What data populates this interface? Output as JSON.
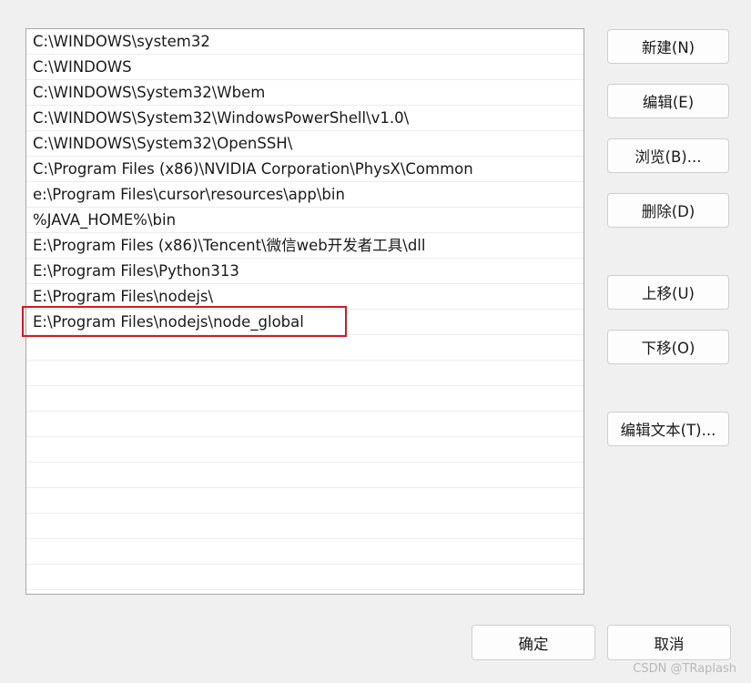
{
  "path_list": {
    "entries": [
      "C:\\WINDOWS\\system32",
      "C:\\WINDOWS",
      "C:\\WINDOWS\\System32\\Wbem",
      "C:\\WINDOWS\\System32\\WindowsPowerShell\\v1.0\\",
      "C:\\WINDOWS\\System32\\OpenSSH\\",
      "C:\\Program Files (x86)\\NVIDIA Corporation\\PhysX\\Common",
      "e:\\Program Files\\cursor\\resources\\app\\bin",
      "%JAVA_HOME%\\bin",
      "E:\\Program Files (x86)\\Tencent\\微信web开发者工具\\dll",
      "E:\\Program Files\\Python313",
      "E:\\Program Files\\nodejs\\",
      "E:\\Program Files\\nodejs\\node_global"
    ],
    "highlighted_index": 11,
    "highlight_color": "#d01b22"
  },
  "buttons": {
    "new": "新建(N)",
    "edit": "编辑(E)",
    "browse": "浏览(B)...",
    "delete": "删除(D)",
    "move_up": "上移(U)",
    "move_down": "下移(O)",
    "edit_text": "编辑文本(T)...",
    "ok": "确定",
    "cancel": "取消"
  },
  "watermark": "CSDN @TRaplash"
}
